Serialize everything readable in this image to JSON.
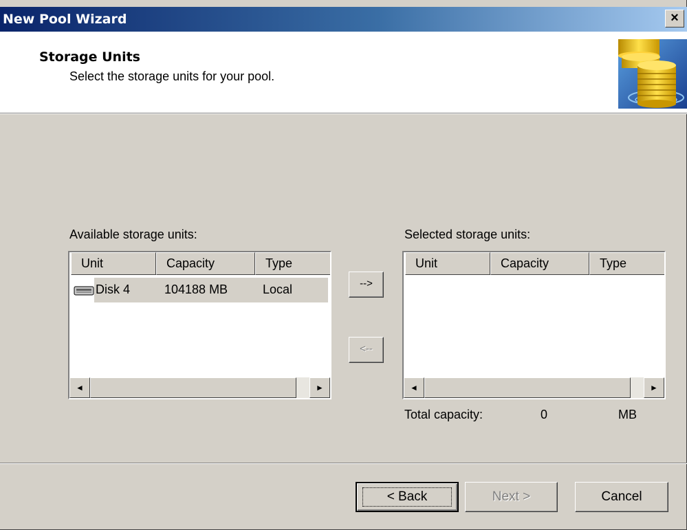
{
  "window": {
    "title": "New Pool Wizard",
    "close": "×"
  },
  "header": {
    "title": "Storage Units",
    "subtitle": "Select the storage units for your pool."
  },
  "available": {
    "label": "Available storage units:",
    "columns": [
      "Unit",
      "Capacity",
      "Type"
    ],
    "rows": [
      {
        "unit": "Disk 4",
        "capacity": "104188 MB",
        "type": "Local"
      }
    ]
  },
  "selected": {
    "label": "Selected storage units:",
    "columns": [
      "Unit",
      "Capacity",
      "Type"
    ]
  },
  "move": {
    "add": "-->",
    "remove": "<--"
  },
  "total": {
    "label": "Total capacity:",
    "value": "0",
    "unit": "MB"
  },
  "scroll": {
    "left": "◄",
    "right": "►"
  },
  "buttons": {
    "back": "< Back",
    "next": "Next >",
    "cancel": "Cancel"
  }
}
